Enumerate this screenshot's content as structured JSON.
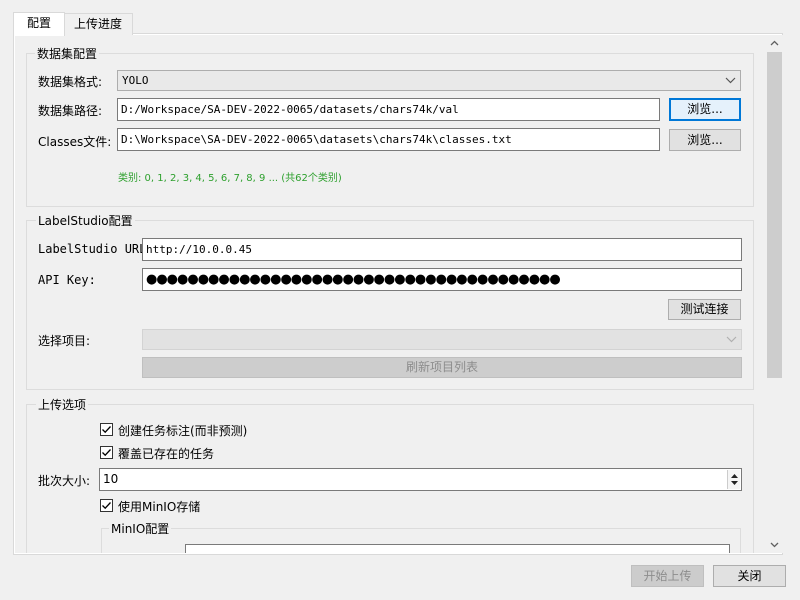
{
  "tabs": [
    {
      "label": "配置"
    },
    {
      "label": "上传进度"
    }
  ],
  "dataset": {
    "group_title": "数据集配置",
    "format_label": "数据集格式:",
    "format_value": "YOLO",
    "path_label": "数据集路径:",
    "path_value": "D:/Workspace/SA-DEV-2022-0065/datasets/chars74k/val",
    "browse_label": "浏览...",
    "classes_label": "Classes文件:",
    "classes_value": "D:\\Workspace\\SA-DEV-2022-0065\\datasets\\chars74k\\classes.txt",
    "browse2_label": "浏览...",
    "classes_info": "类别: 0, 1, 2, 3, 4, 5, 6, 7, 8, 9 ... (共62个类别)",
    "info_color": "#2ea02e"
  },
  "labelstudio": {
    "group_title": "LabelStudio配置",
    "url_label": "LabelStudio URL:",
    "url_value": "http://10.0.0.45",
    "apikey_label": "API Key:",
    "apikey_value": "●●●●●●●●●●●●●●●●●●●●●●●●●●●●●●●●●●●●●●●●",
    "test_button": "测试连接",
    "project_label": "选择项目:",
    "project_value": "",
    "refresh_button": "刷新项目列表"
  },
  "upload_options": {
    "group_title": "上传选项",
    "create_tasks_label": "创建任务标注(而非预测)",
    "create_tasks_checked": true,
    "overwrite_label": "覆盖已存在的任务",
    "overwrite_checked": true,
    "batch_label": "批次大小:",
    "batch_value": "10",
    "minio_label": "使用MinIO存储",
    "minio_checked": true,
    "minio_group_title": "MinIO配置"
  },
  "footer": {
    "start_button": "开始上传",
    "close_button": "关闭"
  },
  "colors": {
    "focus_border": "#0078d7",
    "info_text": "#2ea02e"
  }
}
